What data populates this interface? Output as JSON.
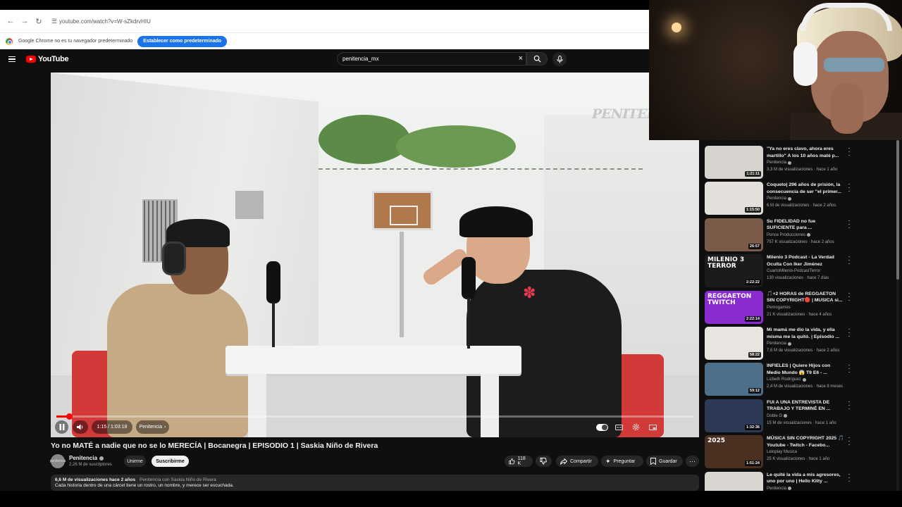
{
  "browser": {
    "url": "youtube.com/watch?v=W-sZkdrvHIU",
    "infobar_message": "Google Chrome no es tu navegador predeterminado",
    "set_default_label": "Establecer como predeterminado"
  },
  "header": {
    "logo_text": "YouTube",
    "search_value": "penitencia_mx"
  },
  "player": {
    "time": "1:15 / 1:03:18",
    "chapter": "Penitencia",
    "progress_fraction": 0.0197,
    "watermark": "PENITEN"
  },
  "video": {
    "title": "Yo no MATÉ a nadie que no se lo MERECÍA | Bocanegra | EPISODIO 1 | Saskia Niño de Rivera",
    "channel": "Penitencia",
    "avatar_text": "penitencia",
    "subscribers": "2,26 M de suscriptores",
    "join_label": "Unirme",
    "subscribe_label": "Suscribirme",
    "likes": "118 K",
    "share_label": "Compartir",
    "ask_label": "Preguntar",
    "save_label": "Guardar",
    "stats": "6,6 M de visualizaciones  hace 2 años",
    "collab": "Penitencia con Saskia Niño de Rivera",
    "description": "Cada historia dentro de una cárcel tiene un rostro, un nombre, y merece ser escuchada."
  },
  "recommendations": [
    {
      "title": "\"Ya no eres clavo, ahora eres martillo\" A los 10 años maté p...",
      "channel": "Penitencia",
      "verified": true,
      "meta": "3,3 M de visualizaciones · hace 1 año",
      "duration": "1:21:11",
      "thumb_bg": "#d7d3cf",
      "thumb_text": ""
    },
    {
      "title": "Coqueto| 296 años de prisión, la consecuencia de ser \"el primer...",
      "channel": "Penitencia",
      "verified": true,
      "meta": "6 M de visualizaciones · hace 2 años",
      "duration": "1:15:50",
      "thumb_bg": "#e3e0dc",
      "thumb_text": ""
    },
    {
      "title": "Su FIDELIDAD no fue SUFICIENTE para ...",
      "channel": "Ponce Producciones",
      "verified": true,
      "meta": "757 K visualizaciones · hace 2 años",
      "duration": "26:57",
      "thumb_bg": "#7a5a48",
      "thumb_text": ""
    },
    {
      "title": "Milenio 3 Podcast - La Verdad Oculta Con Iker Jiménez",
      "channel": "CuartoMilenio-PodcastTerror",
      "verified": false,
      "meta": "130 visualizaciones · hace 7 días",
      "duration": "2:22:22",
      "thumb_bg": "#1b1b1b",
      "thumb_text": "MILENIO 3 TERROR"
    },
    {
      "title": "🎵+2 HORAS de REGGAETON SIN COPYRIGHT🔴 | MUSICA si...",
      "channel": "Pemogames",
      "verified": false,
      "meta": "21 K visualizaciones · hace 4 años",
      "duration": "2:22:14",
      "thumb_bg": "#8a2bd0",
      "thumb_text": "REGGAETON TWITCH"
    },
    {
      "title": "Mi mamá me dio la vida, y ella misma me la quitó. | Episodio ...",
      "channel": "Penitencia",
      "verified": true,
      "meta": "7,6 M de visualizaciones · hace 2 años",
      "duration": "58:22",
      "thumb_bg": "#e8e4e0",
      "thumb_text": ""
    },
    {
      "title": "INFIELES | Quiere Hijos con Medio Mundo 😱 T9 E6 - ...",
      "channel": "Lizbeth Rodríguez",
      "verified": true,
      "meta": "2,4 M de visualizaciones · hace 8 meses",
      "duration": "59:12",
      "thumb_bg": "#4d6f8a",
      "thumb_text": ""
    },
    {
      "title": "FUI A UNA ENTREVISTA DE TRABAJO Y TERMINÉ EN ...",
      "channel": "Doble G",
      "verified": true,
      "meta": "15 M de visualizaciones · hace 1 año",
      "duration": "1:32:36",
      "thumb_bg": "#2e3a55",
      "thumb_text": ""
    },
    {
      "title": "MÚSICA SIN COPYRIGHT 2025 🎵 Youtube - Twitch - Facebo...",
      "channel": "Leloplay Musica",
      "verified": false,
      "meta": "25 K visualizaciones · hace 1 año",
      "duration": "1:51:24",
      "thumb_bg": "#4a3020",
      "thumb_text": "2025"
    },
    {
      "title": "Le quité la vida a mis agresores, uno por uno | Hello Kitty ...",
      "channel": "Penitencia",
      "verified": true,
      "meta": "",
      "duration": "",
      "thumb_bg": "#d9d5d1",
      "thumb_text": ""
    }
  ]
}
